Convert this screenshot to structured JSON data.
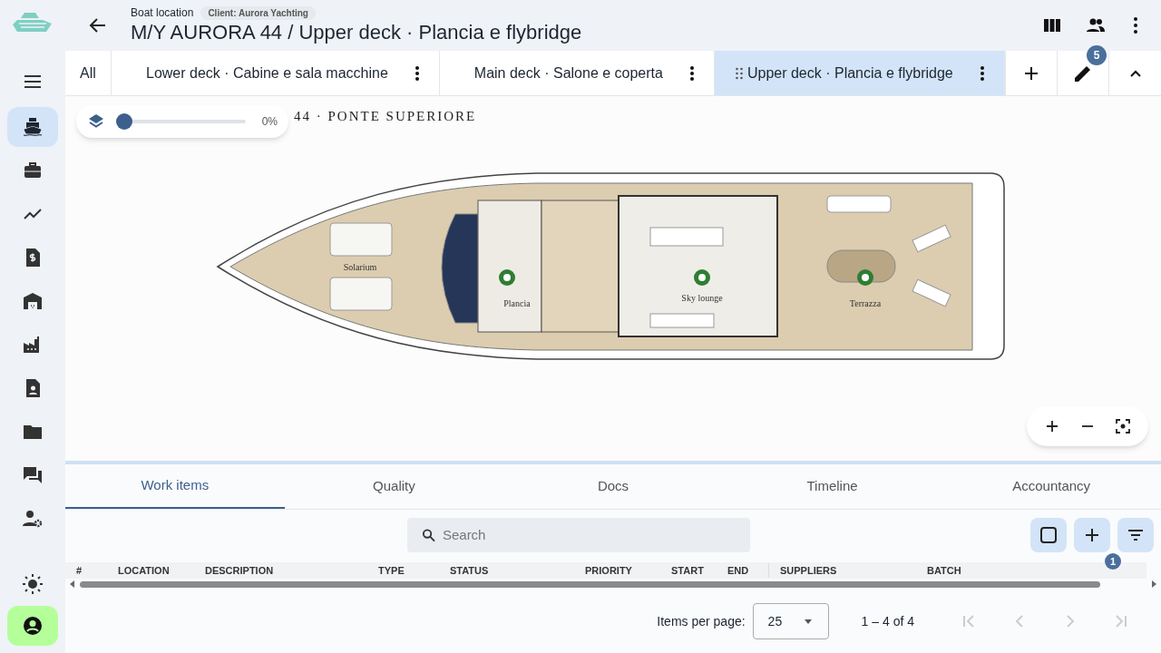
{
  "header": {
    "subtitle": "Boat location",
    "client_chip": "Client: Aurora Yachting",
    "title": "M/Y AURORA 44 / Upper deck · Plancia e flybridge",
    "collaborators_badge": "5"
  },
  "nav": [
    {
      "selected": true
    },
    {
      "selected": false
    },
    {
      "selected": false
    },
    {
      "selected": false
    },
    {
      "selected": false
    },
    {
      "selected": false
    },
    {
      "selected": false
    },
    {
      "selected": false
    },
    {
      "selected": false
    },
    {
      "selected": false
    }
  ],
  "deck_tabs": [
    {
      "label": "All",
      "selected": false,
      "kind": "all"
    },
    {
      "label": "Lower deck · Cabine e sala macchine",
      "selected": false,
      "kind": "deck"
    },
    {
      "label": "Main deck · Salone e coperta",
      "selected": false,
      "kind": "deck"
    },
    {
      "label": "Upper deck · Plancia e flybridge",
      "selected": true,
      "kind": "deck"
    }
  ],
  "layer_slider": {
    "level": 0,
    "reading": "0%"
  },
  "plan": {
    "title": "44 · PONTE SUPERIORE",
    "rooms": [
      {
        "label": "Solarium"
      },
      {
        "label": "Plancia"
      },
      {
        "label": "Sky lounge"
      },
      {
        "label": "Terrazza"
      }
    ]
  },
  "panel_tabs": [
    {
      "label": "Work items",
      "selected": true
    },
    {
      "label": "Quality",
      "selected": false
    },
    {
      "label": "Docs",
      "selected": false
    },
    {
      "label": "Timeline",
      "selected": false
    },
    {
      "label": "Accountancy",
      "selected": false
    }
  ],
  "search": {
    "placeholder": "Search"
  },
  "select_all": {
    "checked": false
  },
  "filter_badge": "1",
  "table": {
    "columns": [
      "#",
      "LOCATION",
      "DESCRIPTION",
      "TYPE",
      "STATUS",
      "PRIORITY",
      "START",
      "END",
      "SUPPLIERS",
      "BATCH"
    ]
  },
  "pagination": {
    "label": "Items per page:",
    "page_size": "25",
    "range": "1 – 4 of 4"
  }
}
